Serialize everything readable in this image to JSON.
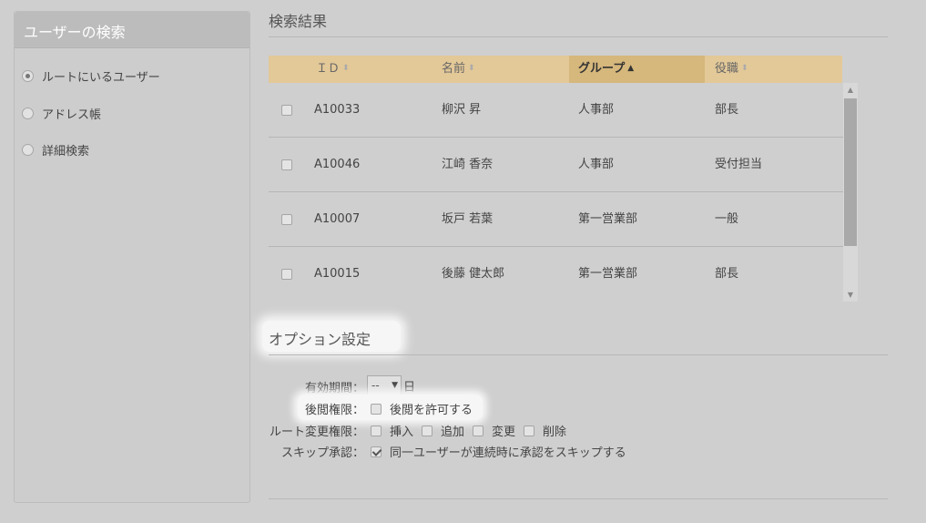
{
  "left": {
    "header": "ユーザーの検索",
    "options": [
      {
        "label": "ルートにいるユーザー",
        "checked": true
      },
      {
        "label": "アドレス帳",
        "checked": false
      },
      {
        "label": "詳細検索",
        "checked": false
      }
    ]
  },
  "results": {
    "title": "検索結果",
    "columns": {
      "id": "ＩＤ",
      "name": "名前",
      "group": "グループ",
      "role": "役職"
    },
    "sorted_column": "group",
    "rows": [
      {
        "id": "A10033",
        "name": "柳沢 昇",
        "group": "人事部",
        "role": "部長"
      },
      {
        "id": "A10046",
        "name": "江崎 香奈",
        "group": "人事部",
        "role": "受付担当"
      },
      {
        "id": "A10007",
        "name": "坂戸 若葉",
        "group": "第一営業部",
        "role": "一般"
      },
      {
        "id": "A10015",
        "name": "後藤 健太郎",
        "group": "第一営業部",
        "role": "部長"
      }
    ]
  },
  "options": {
    "title": "オプション設定",
    "validity": {
      "label": "有効期間：",
      "value": "--",
      "unit": "日"
    },
    "read_permission": {
      "label": "後閲権限：",
      "checkbox": "後閲を許可する",
      "checked": false
    },
    "route_permission": {
      "label": "ルート変更権限：",
      "items": [
        {
          "label": "挿入",
          "checked": false
        },
        {
          "label": "追加",
          "checked": false
        },
        {
          "label": "変更",
          "checked": false
        },
        {
          "label": "削除",
          "checked": false
        }
      ]
    },
    "skip_approval": {
      "label": "スキップ承認：",
      "checkbox": "同一ユーザーが連続時に承認をスキップする",
      "checked": true
    }
  },
  "colors": {
    "table_header": "#e3c898",
    "sorted_header": "#d6b77c",
    "background": "#cfcfcf"
  }
}
